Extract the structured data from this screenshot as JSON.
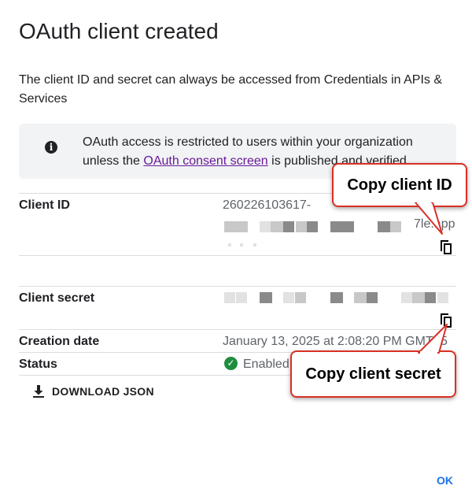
{
  "dialog": {
    "title": "OAuth client created",
    "description": "The client ID and secret can always be accessed from Credentials in APIs & Services"
  },
  "info_banner": {
    "icon": "info-icon",
    "text_before": "OAuth access is restricted to users within your organization unless the ",
    "link_text": "OAuth consent screen",
    "text_after": " is published and verified."
  },
  "fields": {
    "client_id": {
      "label": "Client ID",
      "value_visible": "260226103617-",
      "value_tail": "7le.app"
    },
    "client_secret": {
      "label": "Client secret"
    },
    "creation_date": {
      "label": "Creation date",
      "value": "January 13, 2025 at 2:08:20 PM GMT+5"
    },
    "status": {
      "label": "Status",
      "value": "Enabled",
      "icon": "check-circle-icon",
      "color": "#1e8e3e"
    }
  },
  "actions": {
    "download_json": "DOWNLOAD JSON",
    "ok": "OK",
    "copy_icon": "copy-icon"
  },
  "annotations": {
    "copy_client_id": "Copy client ID",
    "copy_client_secret": "Copy client secret",
    "border_color": "#d93025"
  }
}
